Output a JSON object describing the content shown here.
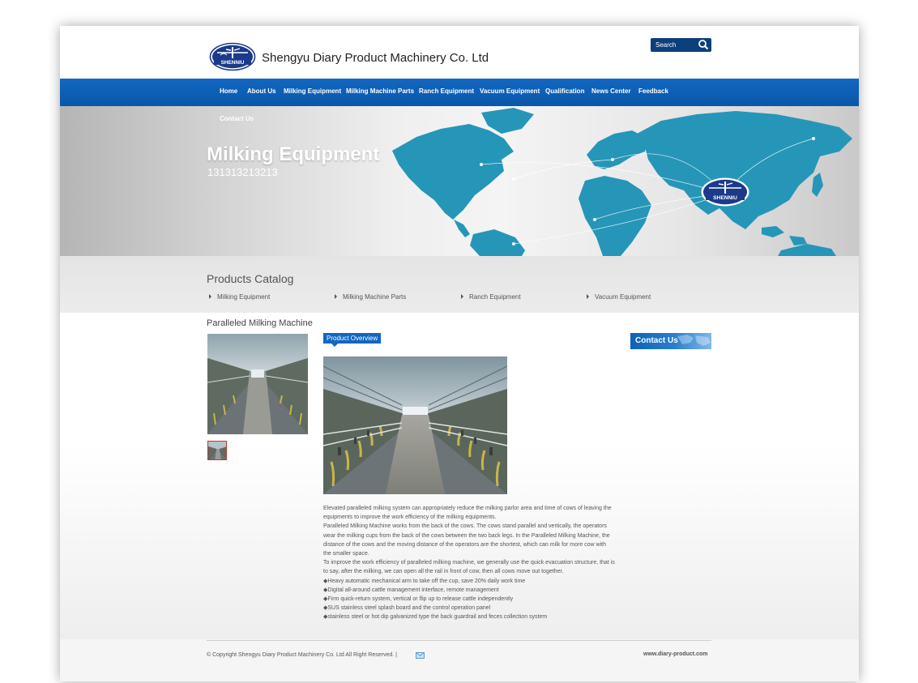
{
  "header": {
    "company_name": "Shengyu Diary Product Machinery Co. Ltd",
    "logo_text": "SHENNIU",
    "search_placeholder": "Search"
  },
  "nav": {
    "items": [
      "Home",
      "About Us",
      "Milking Equipment",
      "Milking Machine Parts",
      "Ranch Equipment",
      "Vacuum Equipment",
      "Qualification",
      "News Center",
      "Feedback"
    ],
    "second_row": "Contact Us"
  },
  "banner": {
    "title": "Milking Equipment",
    "subtitle": "131313213213"
  },
  "catalog": {
    "title": "Products Catalog",
    "items": [
      "Milking Equipment",
      "Milking Machine Parts",
      "Ranch Equipment",
      "Vacuum Equipment"
    ]
  },
  "product": {
    "name": "Paralleled Milking Machine",
    "overview_tab": "Product Overview",
    "description": [
      "Elevated paralleled milking system can appropriately reduce the milking parlor area and time of cows of leaving the equipments to improve the work efficiency of the milking equipments.",
      "Paralleled Milking Machine works from the back of the cows. The cows stand parallel and vertically, the operators wear the milking cups from the back of the cows between the two back legs. In the Paralleled Milking Machine, the distance of the cows and the moving distance of the operators are the shortest, which can milk for more cow with the smaller space.",
      "To improve the work efficiency of paralleled milking machine, we generally use the quick evacuation structure, that is to say, after the milking, we can open all the rail in front of cow, then all cows move out together.",
      "◆Heavy automatic mechanical arm to take off the cup, save 20% daily work time",
      "◆Digital all-around cattle management interface, remote management",
      "◆Firm quick-return system, vertical or flip up to release cattle independently",
      "◆SUS stainless steel splash board and the control operation panel",
      "◆stainless steel or hot dip galvanized type the back guardrail and feces collection system"
    ]
  },
  "sidebar": {
    "contact_title": "Contact Us"
  },
  "footer": {
    "copyright": "© Copyright Shengyu Diary Product Machinery Co. Ltd All Right Reserved.  |",
    "domain": "www.diary-product.com"
  },
  "colors": {
    "nav_blue": "#1167c2",
    "map_teal": "#2596b8",
    "search_navy": "#0d3f7c",
    "logo_navy": "#1b3a8a"
  },
  "icons": [
    "search-icon",
    "mail-icon",
    "arrow-right-icon"
  ]
}
